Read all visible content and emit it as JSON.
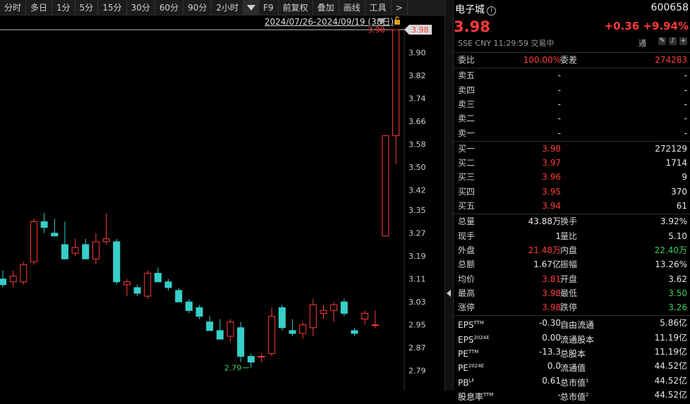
{
  "toolbar": {
    "periods": [
      "分时",
      "多日",
      "1分",
      "5分",
      "15分",
      "30分",
      "60分",
      "90分",
      "2小时"
    ],
    "extras": [
      "F9",
      "前复权",
      "叠加",
      "画线",
      "工具",
      ">"
    ]
  },
  "chart": {
    "range_label": "2024/07/26-2024/09/19 (38日)",
    "last_price_tag": "3.98",
    "high_annotation": "3.98",
    "low_annotation": "2.79",
    "colors": {
      "up": "#ff3b3b",
      "down": "#36cfc9",
      "grid": "#1e1e1e"
    }
  },
  "chart_data": {
    "type": "candlestick",
    "ylim": [
      2.75,
      3.99
    ],
    "y_ticks": [
      "3.90",
      "3.82",
      "3.74",
      "3.66",
      "3.58",
      "3.50",
      "3.42",
      "3.35",
      "3.27",
      "3.19",
      "3.11",
      "3.03",
      "2.95",
      "2.87",
      "2.79"
    ],
    "candles": [
      {
        "o": 3.11,
        "h": 3.14,
        "l": 3.08,
        "c": 3.09
      },
      {
        "o": 3.1,
        "h": 3.14,
        "l": 3.08,
        "c": 3.12
      },
      {
        "o": 3.1,
        "h": 3.17,
        "l": 3.09,
        "c": 3.16
      },
      {
        "o": 3.17,
        "h": 3.32,
        "l": 3.16,
        "c": 3.31
      },
      {
        "o": 3.31,
        "h": 3.34,
        "l": 3.27,
        "c": 3.29
      },
      {
        "o": 3.27,
        "h": 3.32,
        "l": 3.26,
        "c": 3.26
      },
      {
        "o": 3.23,
        "h": 3.31,
        "l": 3.19,
        "c": 3.18
      },
      {
        "o": 3.2,
        "h": 3.25,
        "l": 3.19,
        "c": 3.22
      },
      {
        "o": 3.23,
        "h": 3.25,
        "l": 3.18,
        "c": 3.18
      },
      {
        "o": 3.18,
        "h": 3.27,
        "l": 3.16,
        "c": 3.24
      },
      {
        "o": 3.24,
        "h": 3.34,
        "l": 3.23,
        "c": 3.25
      },
      {
        "o": 3.24,
        "h": 3.25,
        "l": 3.09,
        "c": 3.1
      },
      {
        "o": 3.09,
        "h": 3.11,
        "l": 3.05,
        "c": 3.1
      },
      {
        "o": 3.08,
        "h": 3.09,
        "l": 3.05,
        "c": 3.06
      },
      {
        "o": 3.05,
        "h": 3.14,
        "l": 3.04,
        "c": 3.13
      },
      {
        "o": 3.13,
        "h": 3.15,
        "l": 3.1,
        "c": 3.1
      },
      {
        "o": 3.1,
        "h": 3.11,
        "l": 3.07,
        "c": 3.08
      },
      {
        "o": 3.07,
        "h": 3.08,
        "l": 3.04,
        "c": 3.03
      },
      {
        "o": 3.03,
        "h": 3.04,
        "l": 2.99,
        "c": 3.0
      },
      {
        "o": 3.01,
        "h": 3.02,
        "l": 2.97,
        "c": 2.98
      },
      {
        "o": 2.96,
        "h": 2.98,
        "l": 2.93,
        "c": 2.93
      },
      {
        "o": 2.93,
        "h": 2.97,
        "l": 2.9,
        "c": 2.9
      },
      {
        "o": 2.91,
        "h": 2.97,
        "l": 2.89,
        "c": 2.96
      },
      {
        "o": 2.94,
        "h": 2.96,
        "l": 2.82,
        "c": 2.84
      },
      {
        "o": 2.84,
        "h": 2.85,
        "l": 2.8,
        "c": 2.82
      },
      {
        "o": 2.84,
        "h": 2.85,
        "l": 2.82,
        "c": 2.84
      },
      {
        "o": 2.85,
        "h": 3.01,
        "l": 2.84,
        "c": 2.98
      },
      {
        "o": 3.01,
        "h": 3.02,
        "l": 2.93,
        "c": 2.94
      },
      {
        "o": 2.93,
        "h": 2.97,
        "l": 2.91,
        "c": 2.92
      },
      {
        "o": 2.92,
        "h": 2.96,
        "l": 2.9,
        "c": 2.95
      },
      {
        "o": 2.94,
        "h": 3.04,
        "l": 2.91,
        "c": 3.02
      },
      {
        "o": 2.99,
        "h": 3.02,
        "l": 2.97,
        "c": 3.0
      },
      {
        "o": 3.0,
        "h": 3.03,
        "l": 2.96,
        "c": 3.02
      },
      {
        "o": 3.03,
        "h": 3.04,
        "l": 2.98,
        "c": 2.99
      },
      {
        "o": 2.93,
        "h": 2.94,
        "l": 2.91,
        "c": 2.92
      },
      {
        "o": 2.97,
        "h": 3.0,
        "l": 2.95,
        "c": 2.99
      },
      {
        "o": 2.95,
        "h": 3.0,
        "l": 2.94,
        "c": 2.95
      },
      {
        "o": 3.26,
        "h": 3.61,
        "l": 3.26,
        "c": 3.61
      },
      {
        "o": 3.61,
        "h": 3.98,
        "l": 3.51,
        "c": 3.98
      }
    ]
  },
  "quote": {
    "name": "电子城",
    "code": "600658",
    "price": "3.98",
    "change": "+0.36",
    "change_pct": "+9.94%",
    "meta": "SSE  CNY  11:29:59  交易中",
    "tong": "通",
    "weibi_label": "委比",
    "weibi_value": "100.00%",
    "weicha_label": "委差",
    "weicha_value": "274283",
    "sells": [
      {
        "label": "卖五",
        "price": "-",
        "vol": "-"
      },
      {
        "label": "卖四",
        "price": "-",
        "vol": "-"
      },
      {
        "label": "卖三",
        "price": "-",
        "vol": "-"
      },
      {
        "label": "卖二",
        "price": "-",
        "vol": "-"
      },
      {
        "label": "卖一",
        "price": "-",
        "vol": "-"
      }
    ],
    "buys": [
      {
        "label": "买一",
        "price": "3.98",
        "vol": "272129"
      },
      {
        "label": "买二",
        "price": "3.97",
        "vol": "1714"
      },
      {
        "label": "买三",
        "price": "3.96",
        "vol": "9"
      },
      {
        "label": "买四",
        "price": "3.95",
        "vol": "370"
      },
      {
        "label": "买五",
        "price": "3.94",
        "vol": "61"
      }
    ],
    "stats": [
      {
        "l1": "总量",
        "v1": "43.88万",
        "c1": "white",
        "l2": "换手",
        "v2": "3.92%",
        "c2": "white"
      },
      {
        "l1": "现手",
        "v1": "1",
        "c1": "white",
        "l2": "量比",
        "v2": "5.10",
        "c2": "white"
      },
      {
        "l1": "外盘",
        "v1": "21.48万",
        "c1": "red",
        "l2": "内盘",
        "v2": "22.40万",
        "c2": "green"
      },
      {
        "l1": "总额",
        "v1": "1.67亿",
        "c1": "white",
        "l2": "振幅",
        "v2": "13.26%",
        "c2": "white"
      },
      {
        "l1": "均价",
        "v1": "3.81",
        "c1": "red",
        "l2": "开盘",
        "v2": "3.62",
        "c2": "white"
      },
      {
        "l1": "最高",
        "v1": "3.98",
        "c1": "red",
        "l2": "最低",
        "v2": "3.50",
        "c2": "green"
      },
      {
        "l1": "涨停",
        "v1": "3.98",
        "c1": "red",
        "l2": "跌停",
        "v2": "3.26",
        "c2": "green"
      }
    ],
    "fundamentals": [
      {
        "l1": "EPS",
        "s1": "TTM",
        "v1": "-0.30",
        "l2": "自由流通",
        "s2": "",
        "v2": "5.86亿"
      },
      {
        "l1": "EPS",
        "s1": "2024E",
        "v1": "0.00",
        "l2": "流通股本",
        "s2": "",
        "v2": "11.19亿"
      },
      {
        "l1": "PE",
        "s1": "TTM",
        "v1": "-13.3",
        "l2": "总股本",
        "s2": "",
        "v2": "11.19亿"
      },
      {
        "l1": "PE",
        "s1": "2024E",
        "v1": "0.0",
        "l2": "流通值",
        "s2": "",
        "v2": "44.52亿"
      },
      {
        "l1": "PB",
        "s1": "LF",
        "v1": "0.61",
        "l2": "总市值",
        "s2": "1",
        "v2": "44.52亿"
      },
      {
        "l1": "股息率",
        "s1": "TTM",
        "v1": "-",
        "l2": "总市值",
        "s2": "2",
        "v2": "44.52亿"
      }
    ]
  }
}
